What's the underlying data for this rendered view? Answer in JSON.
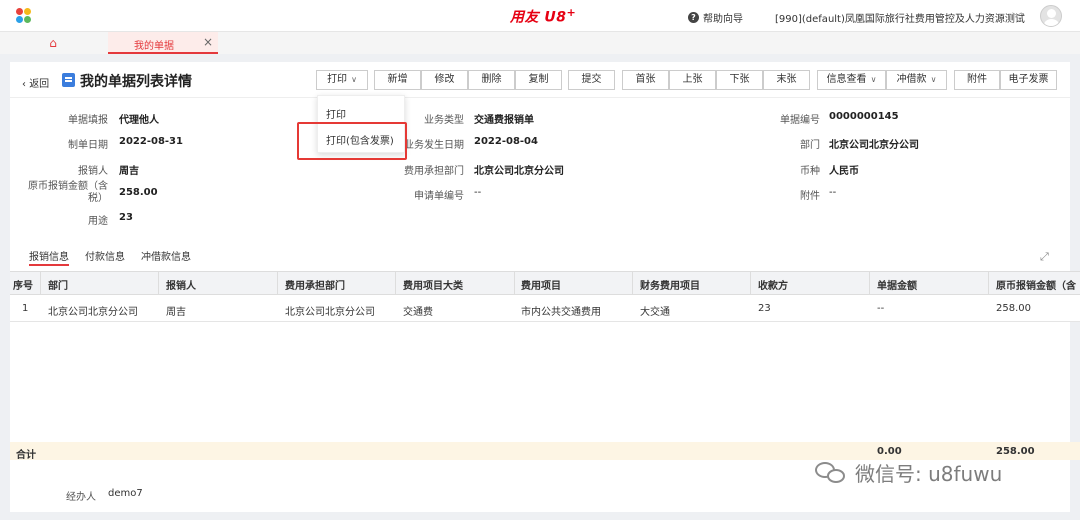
{
  "header": {
    "brand": "用友 U8",
    "brand_plus": "+",
    "help": "帮助向导",
    "org": "[990](default)凤凰国际旅行社费用管控及人力资源测试",
    "logo_colors": [
      "#e8413c",
      "#f6b91a",
      "#2aa0e8",
      "#5cb85c"
    ]
  },
  "tabs": {
    "home_icon": "home-icon",
    "active_tab": "我的单据"
  },
  "titlebar": {
    "back": "返回",
    "title": "我的单据列表详情"
  },
  "toolbar": {
    "print": "打印",
    "add": "新增",
    "edit": "修改",
    "delete": "删除",
    "copy": "复制",
    "submit": "提交",
    "first": "首张",
    "prev": "上张",
    "next": "下张",
    "last": "末张",
    "info": "信息查看",
    "offset": "冲借款",
    "attach": "附件",
    "einvoice": "电子发票"
  },
  "print_menu": {
    "items": [
      "打印",
      "打印(包含发票)"
    ]
  },
  "form": {
    "col1": [
      {
        "label": "单据填报",
        "value": "代理他人"
      },
      {
        "label": "制单日期",
        "value": "2022-08-31"
      },
      {
        "label": "报销人",
        "value": "周吉"
      },
      {
        "label": "原币报销金额（含税）",
        "value": "258.00"
      },
      {
        "label": "用途",
        "value": "23"
      }
    ],
    "col2": [
      {
        "label": "业务类型",
        "value": "交通费报销单"
      },
      {
        "label": "业务发生日期",
        "value": "2022-08-04"
      },
      {
        "label": "费用承担部门",
        "value": "北京公司北京分公司"
      },
      {
        "label": "申请单编号",
        "value": "--"
      }
    ],
    "col3": [
      {
        "label": "单据编号",
        "value": "0000000145"
      },
      {
        "label": "部门",
        "value": "北京公司北京分公司"
      },
      {
        "label": "币种",
        "value": "人民币"
      },
      {
        "label": "附件",
        "value": "--"
      }
    ]
  },
  "detail_tabs": [
    "报销信息",
    "付款信息",
    "冲借款信息"
  ],
  "table": {
    "columns": [
      "序号",
      "部门",
      "报销人",
      "费用承担部门",
      "费用项目大类",
      "费用项目",
      "财务费用项目",
      "收款方",
      "单据金额",
      "原币报销金额（含"
    ],
    "rows": [
      [
        "1",
        "北京公司北京分公司",
        "周吉",
        "北京公司北京分公司",
        "交通费",
        "市内公共交通费用",
        "大交通",
        "23",
        "--",
        "258.00"
      ]
    ],
    "total_label": "合计",
    "total_amount": "0.00",
    "total_reimb": "258.00"
  },
  "footer": {
    "handler_label": "经办人",
    "handler_value": "demo7"
  },
  "watermark": "微信号: u8fuwu"
}
